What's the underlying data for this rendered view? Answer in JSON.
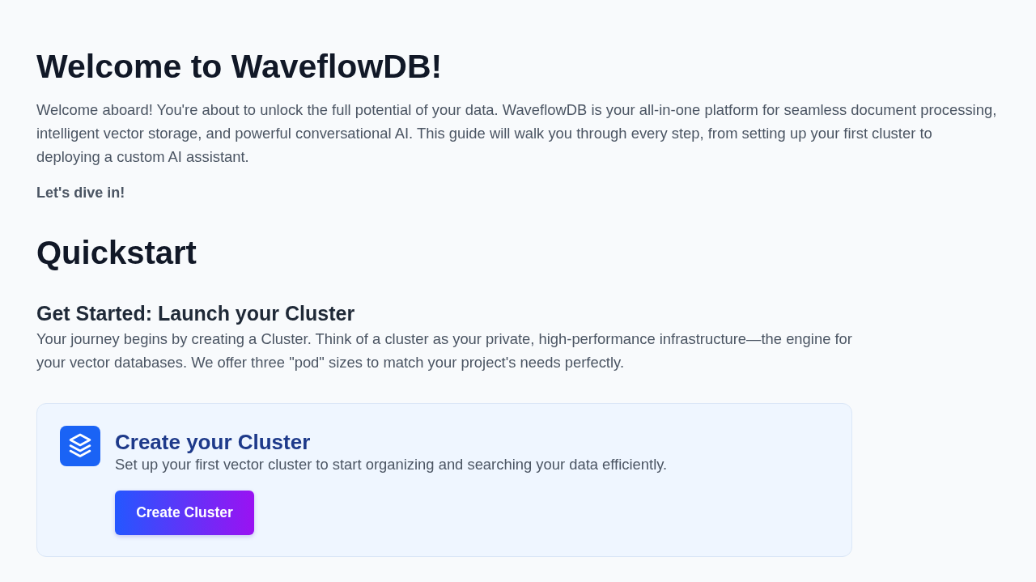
{
  "heading": "Welcome to WaveflowDB!",
  "intro": "Welcome aboard! You're about to unlock the full potential of your data. WaveflowDB is your all-in-one platform for seamless document processing, intelligent vector storage, and powerful conversational AI. This guide will walk you through every step, from setting up your first cluster to deploying a custom AI assistant.",
  "callout": "Let's dive in!",
  "section": {
    "title": "Quickstart",
    "subsection": {
      "title": "Get Started: Launch your Cluster",
      "description": "Your journey begins by creating a Cluster. Think of a cluster as your private, high-performance infrastructure—the engine for your vector databases. We offer three \"pod\" sizes to match your project's needs perfectly."
    },
    "card": {
      "title": "Create your Cluster",
      "description": "Set up your first vector cluster to start organizing and searching your data efficiently.",
      "button": "Create Cluster"
    }
  }
}
